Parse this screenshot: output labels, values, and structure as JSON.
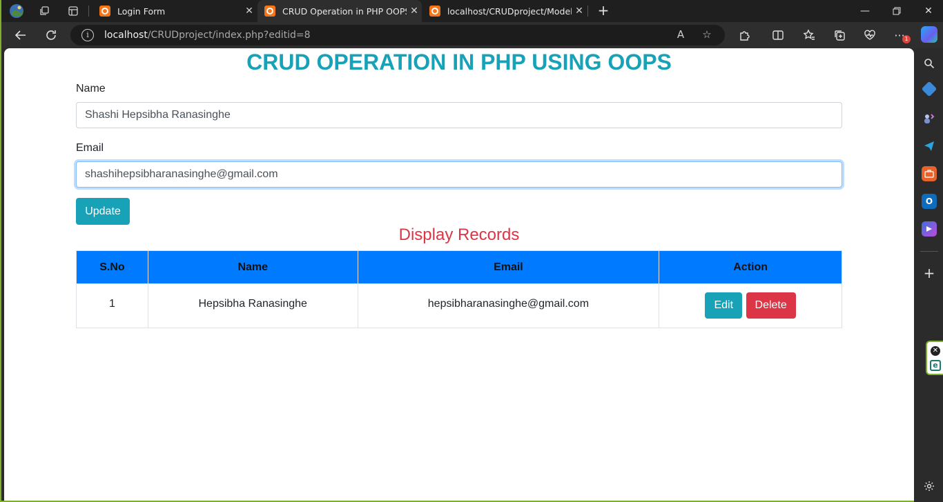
{
  "browser": {
    "tabs": [
      {
        "label": "Login Form",
        "active": false
      },
      {
        "label": "CRUD Operation in PHP OOPS",
        "active": true
      },
      {
        "label": "localhost/CRUDproject/Model.ph",
        "active": false
      }
    ],
    "address": {
      "host": "localhost",
      "path": "/CRUDproject/index.php?editid=8"
    },
    "notification_count": "1"
  },
  "page": {
    "heading": "CRUD OPERATION IN PHP USING OOPS",
    "form": {
      "name_label": "Name",
      "name_value": "Shashi Hepsibha Ranasinghe",
      "email_label": "Email",
      "email_value": "shashihepsibharanasinghe@gmail.com",
      "submit_label": "Update"
    },
    "records_title": "Display Records",
    "table": {
      "headers": [
        "S.No",
        "Name",
        "Email",
        "Action"
      ],
      "rows": [
        {
          "sno": "1",
          "name": "Hepsibha Ranasinghe",
          "email": "hepsibharanasinghe@gmail.com",
          "edit_label": "Edit",
          "delete_label": "Delete"
        }
      ]
    }
  },
  "colors": {
    "accent_teal": "#17a2b8",
    "header_blue": "#007bff",
    "danger_red": "#dc3545"
  }
}
